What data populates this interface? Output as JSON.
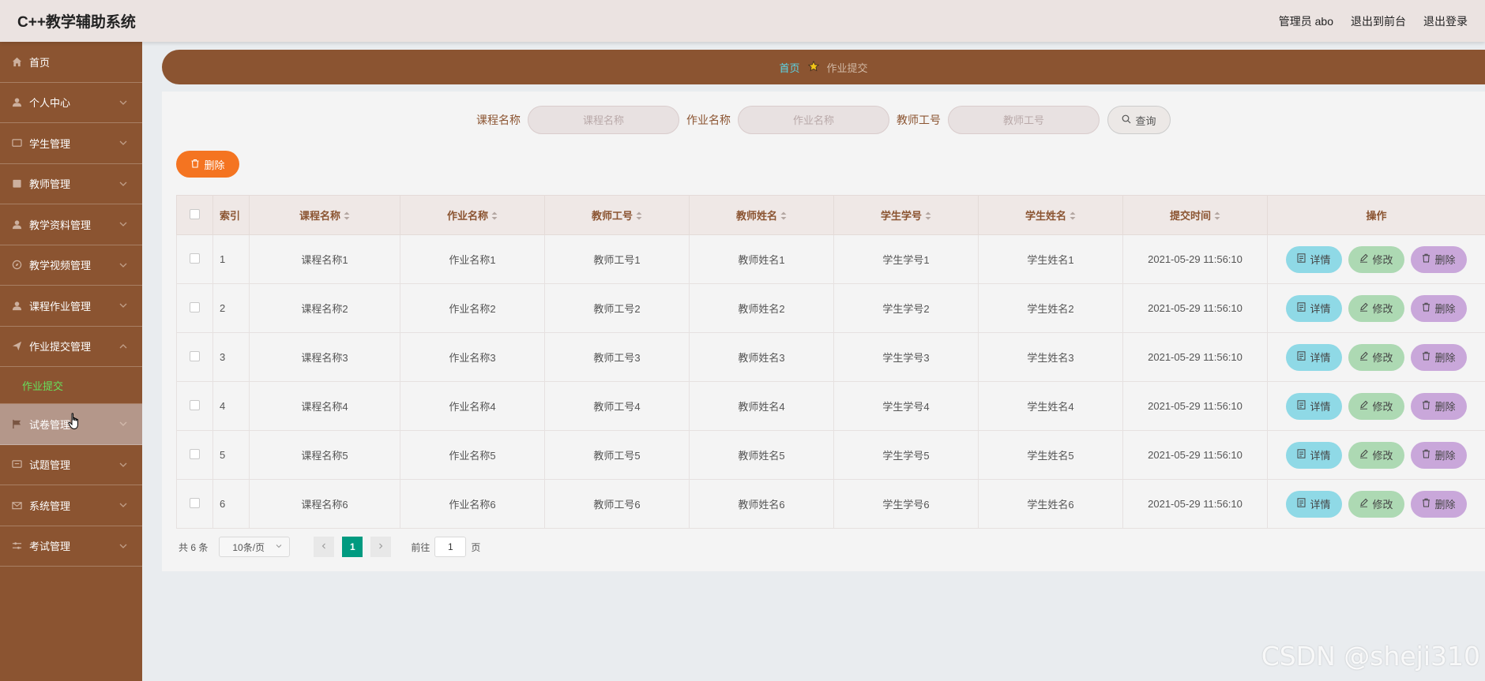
{
  "header": {
    "app_title": "C++教学辅助系统",
    "user_label": "管理员 abo",
    "frontend_link": "退出到前台",
    "logout_link": "退出登录"
  },
  "sidebar": {
    "items": [
      {
        "label": "首页",
        "icon": "home-icon"
      },
      {
        "label": "个人中心",
        "icon": "user-icon"
      },
      {
        "label": "学生管理",
        "icon": "message-icon"
      },
      {
        "label": "教师管理",
        "icon": "calendar-icon"
      },
      {
        "label": "教学资料管理",
        "icon": "user-icon"
      },
      {
        "label": "教学视频管理",
        "icon": "compass-icon"
      },
      {
        "label": "课程作业管理",
        "icon": "user-icon"
      },
      {
        "label": "作业提交管理",
        "icon": "send-icon"
      },
      {
        "label": "试卷管理",
        "icon": "flag-icon"
      },
      {
        "label": "试题管理",
        "icon": "chat-icon"
      },
      {
        "label": "系统管理",
        "icon": "mail-icon"
      },
      {
        "label": "考试管理",
        "icon": "sliders-icon"
      }
    ],
    "submenu_label": "作业提交"
  },
  "breadcrumb": {
    "home": "首页",
    "current": "作业提交"
  },
  "search": {
    "course_label": "课程名称",
    "course_placeholder": "课程名称",
    "homework_label": "作业名称",
    "homework_placeholder": "作业名称",
    "teacher_no_label": "教师工号",
    "teacher_no_placeholder": "教师工号",
    "query_button": "查询"
  },
  "toolbar": {
    "delete_button": "删除"
  },
  "table": {
    "columns": [
      "索引",
      "课程名称",
      "作业名称",
      "教师工号",
      "教师姓名",
      "学生学号",
      "学生姓名",
      "提交时间",
      "操作"
    ],
    "rows": [
      {
        "index": "1",
        "course": "课程名称1",
        "homework": "作业名称1",
        "teacher_no": "教师工号1",
        "teacher_name": "教师姓名1",
        "student_no": "学生学号1",
        "student_name": "学生姓名1",
        "time": "2021-05-29 11:56:10"
      },
      {
        "index": "2",
        "course": "课程名称2",
        "homework": "作业名称2",
        "teacher_no": "教师工号2",
        "teacher_name": "教师姓名2",
        "student_no": "学生学号2",
        "student_name": "学生姓名2",
        "time": "2021-05-29 11:56:10"
      },
      {
        "index": "3",
        "course": "课程名称3",
        "homework": "作业名称3",
        "teacher_no": "教师工号3",
        "teacher_name": "教师姓名3",
        "student_no": "学生学号3",
        "student_name": "学生姓名3",
        "time": "2021-05-29 11:56:10"
      },
      {
        "index": "4",
        "course": "课程名称4",
        "homework": "作业名称4",
        "teacher_no": "教师工号4",
        "teacher_name": "教师姓名4",
        "student_no": "学生学号4",
        "student_name": "学生姓名4",
        "time": "2021-05-29 11:56:10"
      },
      {
        "index": "5",
        "course": "课程名称5",
        "homework": "作业名称5",
        "teacher_no": "教师工号5",
        "teacher_name": "教师姓名5",
        "student_no": "学生学号5",
        "student_name": "学生姓名5",
        "time": "2021-05-29 11:56:10"
      },
      {
        "index": "6",
        "course": "课程名称6",
        "homework": "作业名称6",
        "teacher_no": "教师工号6",
        "teacher_name": "教师姓名6",
        "student_no": "学生学号6",
        "student_name": "学生姓名6",
        "time": "2021-05-29 11:56:10"
      }
    ],
    "actions": {
      "detail": "详情",
      "edit": "修改",
      "delete": "删除"
    }
  },
  "pagination": {
    "total": "共 6 条",
    "page_size": "10条/页",
    "current_page": "1",
    "goto_prefix": "前往",
    "goto_value": "1",
    "goto_suffix": "页"
  },
  "watermark": "CSDN @sheji310",
  "colors": {
    "sidebar_bg": "#8b5431",
    "topbar_bg": "#ebe3e1",
    "delete_orange": "#f47421",
    "detail_blue": "#8fd9e6",
    "edit_green": "#add9b3",
    "delete_purple": "#c9a7da",
    "active_page": "#009a80",
    "submenu_active": "#66e05c"
  }
}
